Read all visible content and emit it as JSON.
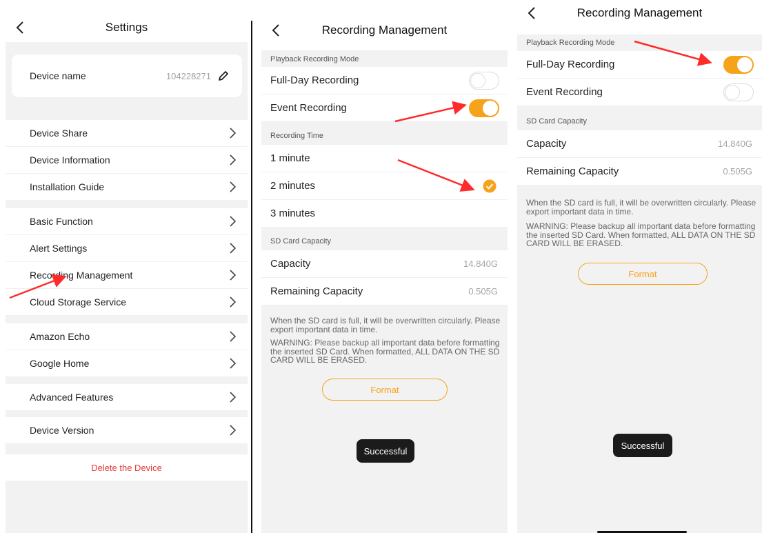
{
  "colors": {
    "accent": "#f7a21b",
    "danger": "#e53935",
    "annotation": "#ff2a2a"
  },
  "settings": {
    "title": "Settings",
    "device_name_label": "Device name",
    "device_name_value": "104228271",
    "items": [
      {
        "label": "Device Share"
      },
      {
        "label": "Device Information"
      },
      {
        "label": "Installation Guide"
      },
      {
        "label": "Basic Function"
      },
      {
        "label": "Alert Settings"
      },
      {
        "label": "Recording Management"
      },
      {
        "label": "Cloud Storage Service"
      },
      {
        "label": "Amazon Echo"
      },
      {
        "label": "Google Home"
      },
      {
        "label": "Advanced Features"
      },
      {
        "label": "Device Version"
      }
    ],
    "delete_label": "Delete the Device"
  },
  "recording_a": {
    "title": "Recording Management",
    "mode_header": "Playback Recording Mode",
    "full_day_label": "Full-Day Recording",
    "full_day_on": false,
    "event_label": "Event Recording",
    "event_on": true,
    "time_header": "Recording Time",
    "times": [
      "1 minute",
      "2 minutes",
      "3 minutes"
    ],
    "selected_time": "2 minutes",
    "sd_header": "SD Card Capacity",
    "capacity_label": "Capacity",
    "capacity_value": "14.840G",
    "remaining_label": "Remaining Capacity",
    "remaining_value": "0.505G",
    "note1": "When the SD card is full, it will be overwritten circularly. Please export important data in time.",
    "note2": "WARNING: Please backup all important data before formatting the inserted SD Card. When formatted, ALL DATA ON THE SD CARD WILL BE ERASED.",
    "format_label": "Format",
    "toast": "Successful"
  },
  "recording_b": {
    "title": "Recording Management",
    "mode_header": "Playback Recording Mode",
    "full_day_label": "Full-Day Recording",
    "full_day_on": true,
    "event_label": "Event Recording",
    "event_on": false,
    "sd_header": "SD Card Capacity",
    "capacity_label": "Capacity",
    "capacity_value": "14.840G",
    "remaining_label": "Remaining Capacity",
    "remaining_value": "0.505G",
    "note1": "When the SD card is full, it will be overwritten circularly. Please export important data in time.",
    "note2": "WARNING: Please backup all important data before formatting the inserted SD Card. When formatted, ALL DATA ON THE SD CARD WILL BE ERASED.",
    "format_label": "Format",
    "toast": "Successful"
  }
}
